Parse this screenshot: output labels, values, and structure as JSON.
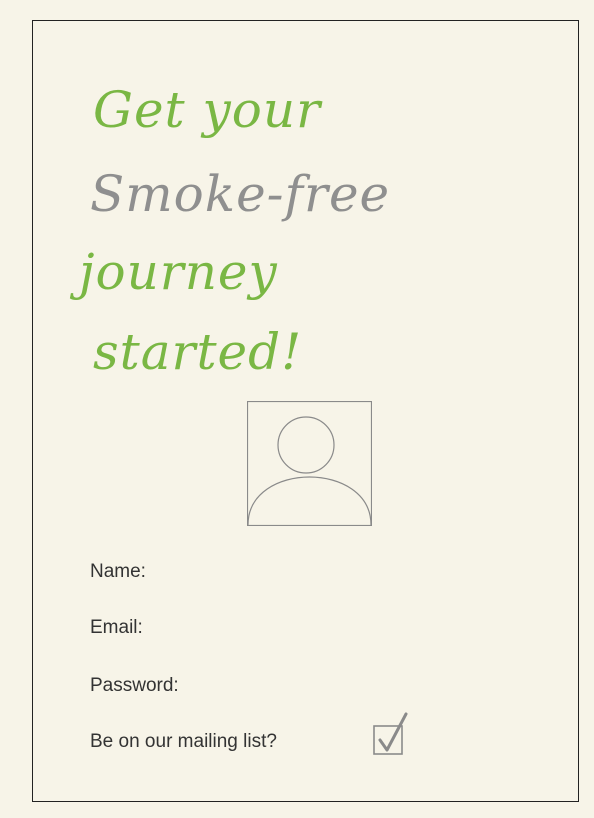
{
  "headline": {
    "line1": "Get your",
    "line2": "Smoke-free",
    "line3": "journey",
    "line4": "started!"
  },
  "form": {
    "name_label": "Name:",
    "email_label": "Email:",
    "password_label": "Password:",
    "mailing_label": "Be on our mailing list?",
    "mailing_checked": true
  },
  "icons": {
    "avatar": "user-avatar-placeholder-icon",
    "checkbox": "checkmark-icon"
  },
  "colors": {
    "accent_green": "#7ab744",
    "accent_grey": "#8f8f8f",
    "background": "#f7f4e8"
  }
}
